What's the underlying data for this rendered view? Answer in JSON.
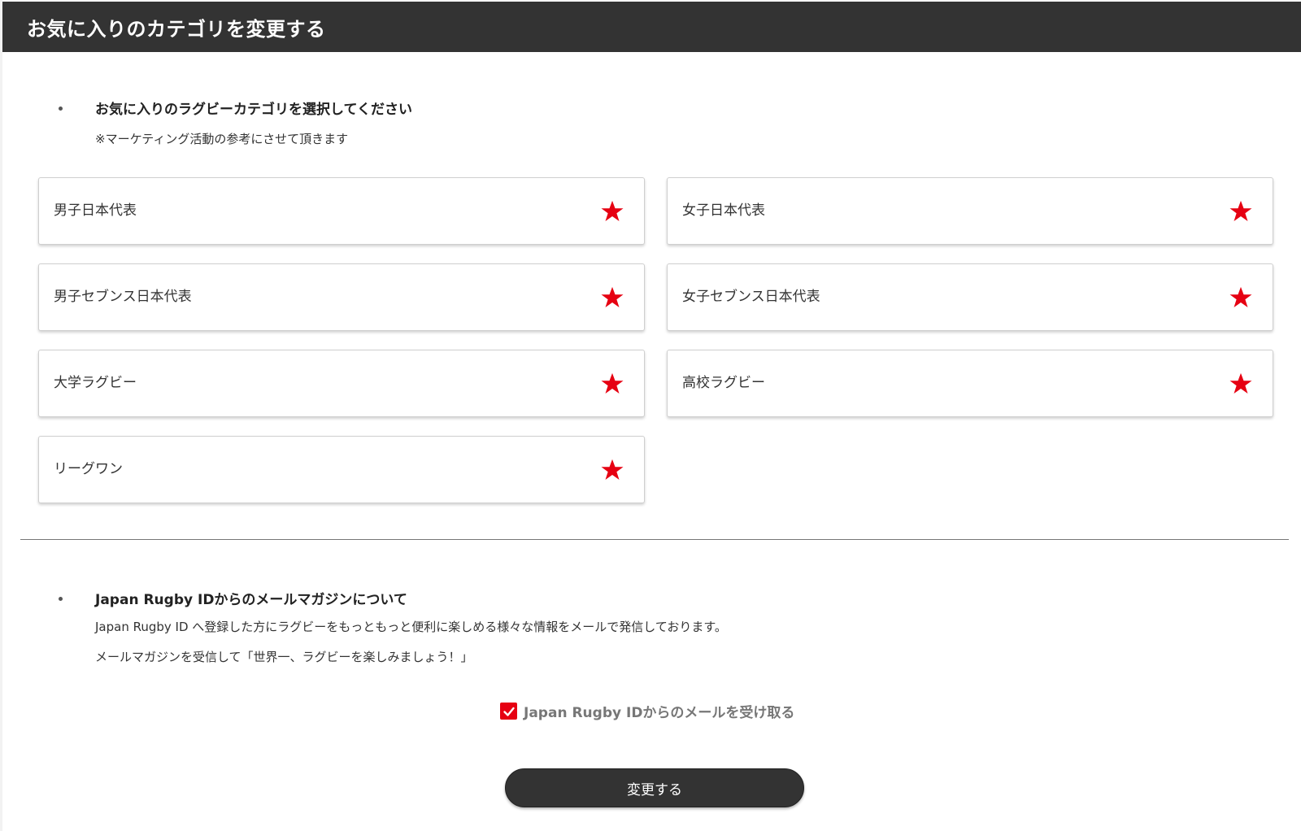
{
  "header": {
    "title": "お気に入りのカテゴリを変更する"
  },
  "category_section": {
    "title": "お気に入りのラグビーカテゴリを選択してください",
    "note": "※マーケティング活動の参考にさせて頂きます",
    "items": [
      {
        "label": "男子日本代表",
        "icon": "star-icon",
        "favorited": true
      },
      {
        "label": "女子日本代表",
        "icon": "star-icon",
        "favorited": true
      },
      {
        "label": "男子セブンス日本代表",
        "icon": "star-icon",
        "favorited": true
      },
      {
        "label": "女子セブンス日本代表",
        "icon": "star-icon",
        "favorited": true
      },
      {
        "label": "大学ラグビー",
        "icon": "star-icon",
        "favorited": true
      },
      {
        "label": "高校ラグビー",
        "icon": "star-icon",
        "favorited": true
      },
      {
        "label": "リーグワン",
        "icon": "star-icon",
        "favorited": true
      }
    ]
  },
  "mail_section": {
    "title": "Japan Rugby IDからのメールマガジンについて",
    "line1": "Japan Rugby ID へ登録した方にラグビーをもっともっと便利に楽しめる様々な情報をメールで発信しております。",
    "line2": "メールマガジンを受信して「世界一、ラグビーを楽しみましょう！」",
    "consent_label": "Japan Rugby IDからのメールを受け取る",
    "consent_checked": true
  },
  "submit_label": "変更する",
  "colors": {
    "header_bg": "#333333",
    "accent": "#e60012",
    "button_bg": "#333333"
  }
}
